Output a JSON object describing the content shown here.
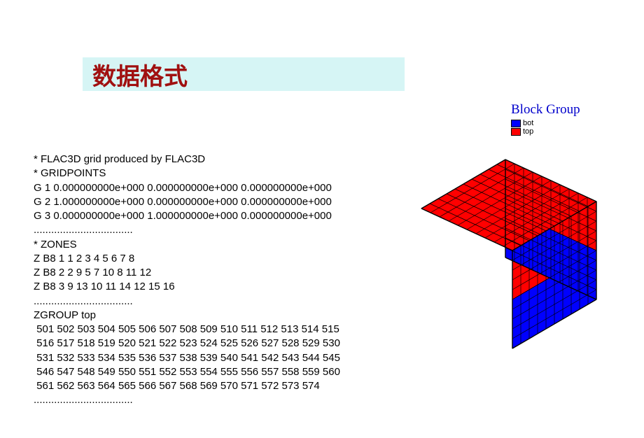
{
  "title": "数据格式",
  "legend": {
    "title": "Block Group",
    "items": [
      {
        "label": "bot",
        "color": "#0000ff"
      },
      {
        "label": "top",
        "color": "#ff0000"
      }
    ]
  },
  "lines": [
    "* FLAC3D grid produced by FLAC3D",
    "* GRIDPOINTS",
    "G 1 0.000000000e+000 0.000000000e+000 0.000000000e+000",
    "G 2 1.000000000e+000 0.000000000e+000 0.000000000e+000",
    "G 3 0.000000000e+000 1.000000000e+000 0.000000000e+000",
    "..................................",
    "* ZONES",
    "Z B8 1 1 2 3 4 5 6 7 8",
    "Z B8 2 2 9 5 7 10 8 11 12",
    "Z B8 3 9 13 10 11 14 12 15 16",
    "..................................",
    "ZGROUP top",
    " 501 502 503 504 505 506 507 508 509 510 511 512 513 514 515",
    " 516 517 518 519 520 521 522 523 524 525 526 527 528 529 530",
    " 531 532 533 534 535 536 537 538 539 540 541 542 543 544 545",
    " 546 547 548 549 550 551 552 553 554 555 556 557 558 559 560",
    " 561 562 563 564 565 566 567 568 569 570 571 572 573 574",
    ".................................."
  ],
  "cube": {
    "colors": {
      "top": "#ff0000",
      "bot": "#0000ff"
    },
    "grid": 10
  }
}
